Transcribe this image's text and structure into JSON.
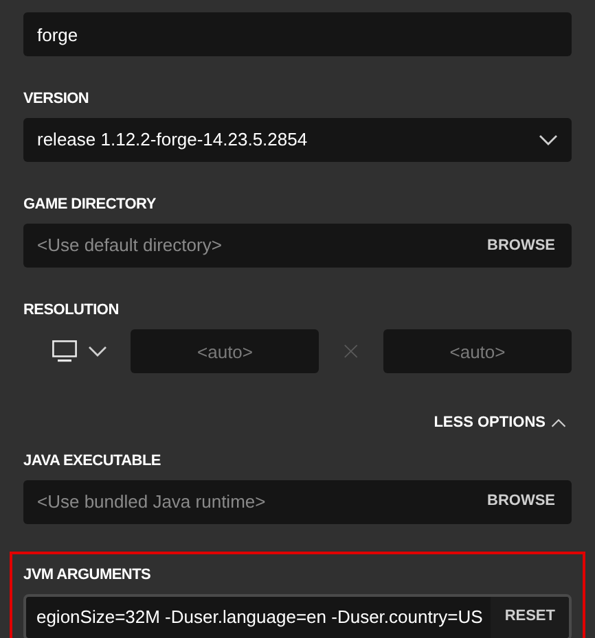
{
  "name_field": {
    "value": "forge"
  },
  "version": {
    "label": "VERSION",
    "value": "release 1.12.2-forge-14.23.5.2854"
  },
  "game_directory": {
    "label": "GAME DIRECTORY",
    "placeholder": "<Use default directory>",
    "button": "BROWSE"
  },
  "resolution": {
    "label": "RESOLUTION",
    "width_placeholder": "<auto>",
    "height_placeholder": "<auto>"
  },
  "options_toggle": {
    "label": "LESS OPTIONS",
    "expanded": true
  },
  "java_executable": {
    "label": "JAVA EXECUTABLE",
    "placeholder": "<Use bundled Java runtime>",
    "button": "BROWSE"
  },
  "jvm_arguments": {
    "label": "JVM ARGUMENTS",
    "value": "egionSize=32M -Duser.language=en -Duser.country=US",
    "button": "RESET",
    "highlighted": true
  }
}
